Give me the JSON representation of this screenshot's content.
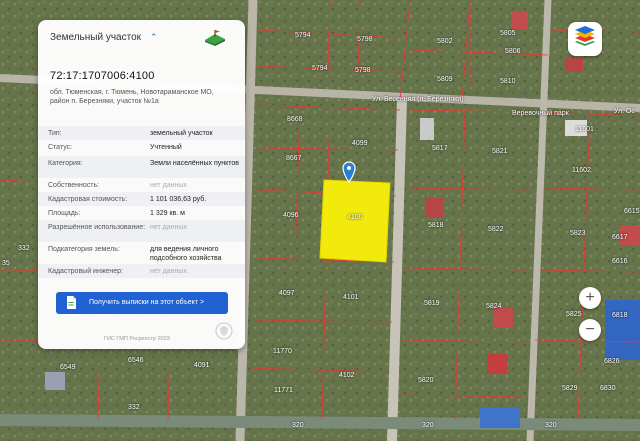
{
  "panel": {
    "title": "Земельный участок",
    "chevron": "⌃",
    "cadastral_number": "72:17:1707006:4100",
    "address": "обл. Тюменская, г. Тюмень, Новотараманское МО, район п. Березняки, участок №1а",
    "rows": [
      {
        "label": "Тип:",
        "value": "земельный участок"
      },
      {
        "label": "Статус:",
        "value": "Учтенный"
      },
      {
        "label": "Категория:",
        "value": "Земли населённых пунктов"
      },
      {
        "label": "Собственность:",
        "value": "нет данных"
      },
      {
        "label": "Кадастровая стоимость:",
        "value": "1 101 036,63 руб."
      },
      {
        "label": "Площадь:",
        "value": "1 329 кв. м"
      },
      {
        "label": "Разрешённое использование:",
        "value": "нет данных"
      },
      {
        "label": "Подкатегория земель:",
        "value": "для ведения личного подсобного хозяйства"
      },
      {
        "label": "Кадастровый инженер:",
        "value": "нет данных"
      }
    ],
    "button_label": "Получить выписки на этот объект >",
    "footer": "ГИС ГМП Росреестр 2023"
  },
  "map": {
    "road_label": "Ул. Весенняя (п. Березняки)",
    "poi_label": "Веревочный парк",
    "road_label_right": "Ул. Ос",
    "parcel_numbers": [
      "5794",
      "5798",
      "5802",
      "5805",
      "5806",
      "5794",
      "5798",
      "5809",
      "5810",
      "4099",
      "8668",
      "5817",
      "5821",
      "11601",
      "11602",
      "8667",
      "6615",
      "4096",
      "4100",
      "5818",
      "5822",
      "5823",
      "6617",
      "6616",
      "4097",
      "4101",
      "5819",
      "5824",
      "5825",
      "6818",
      "332",
      "11770",
      "6546",
      "4091",
      "4102",
      "5820",
      "6549",
      "11771",
      "6826",
      "5829",
      "6830",
      "332",
      "320",
      "320",
      "320",
      "35"
    ]
  },
  "controls": {
    "zoom_in": "+",
    "zoom_out": "−",
    "layers_icon": "layers-icon"
  },
  "colors": {
    "selected_parcel": "#f2ea0b",
    "boundary": "#e53935",
    "button": "#2161d1",
    "pin": "#2a7fd4"
  }
}
